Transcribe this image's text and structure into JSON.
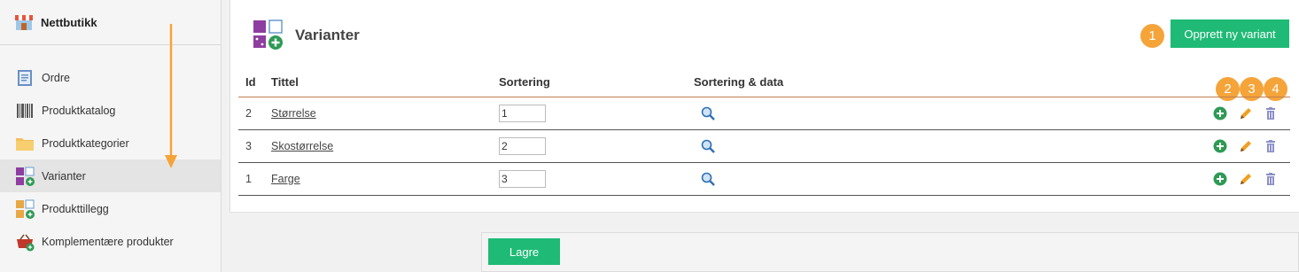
{
  "sidebar": {
    "title": "Nettbutikk",
    "items": [
      {
        "label": "Ordre",
        "icon": "order-icon"
      },
      {
        "label": "Produktkatalog",
        "icon": "barcode-icon"
      },
      {
        "label": "Produktkategorier",
        "icon": "folder-icon"
      },
      {
        "label": "Varianter",
        "icon": "variants-icon",
        "active": true
      },
      {
        "label": "Produkttillegg",
        "icon": "addons-icon"
      },
      {
        "label": "Komplementære produkter",
        "icon": "basket-icon"
      }
    ]
  },
  "header": {
    "title": "Varianter",
    "create_label": "Opprett ny variant"
  },
  "table": {
    "columns": [
      "Id",
      "Tittel",
      "Sortering",
      "Sortering & data"
    ],
    "rows": [
      {
        "id": "2",
        "title": "Størrelse",
        "sort": "1"
      },
      {
        "id": "3",
        "title": "Skostørrelse",
        "sort": "2"
      },
      {
        "id": "1",
        "title": "Farge",
        "sort": "3"
      }
    ]
  },
  "badges": [
    "1",
    "2",
    "3",
    "4"
  ],
  "footer": {
    "save_label": "Lagre"
  },
  "colors": {
    "accent_green": "#1fba76",
    "badge_orange": "#f5a43a",
    "active_item_bg": "#e4e4e4"
  }
}
